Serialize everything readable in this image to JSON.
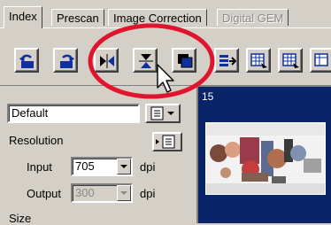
{
  "tabs": [
    {
      "label": "Index",
      "active": true,
      "enabled": true
    },
    {
      "label": "Prescan",
      "active": false,
      "enabled": true
    },
    {
      "label": "Image Correction",
      "active": false,
      "enabled": true
    },
    {
      "label": "Digital GEM",
      "active": false,
      "enabled": false
    }
  ],
  "toolbar": {
    "buttons": [
      {
        "icon": "rotate-left-icon"
      },
      {
        "icon": "rotate-right-icon"
      },
      {
        "icon": "flip-horizontal-icon"
      },
      {
        "icon": "flip-vertical-icon"
      },
      {
        "icon": "overlay-frames-icon"
      },
      {
        "icon": "frame-arrow-icon"
      },
      {
        "icon": "grid-select-icon"
      },
      {
        "icon": "grid-select-alt-icon"
      },
      {
        "icon": "grid-extra-icon"
      }
    ]
  },
  "settings": {
    "preset_value": "Default",
    "resolution_label": "Resolution",
    "input_label": "Input",
    "input_value": "705",
    "input_unit": "dpi",
    "output_label": "Output",
    "output_value": "300",
    "output_unit": "dpi",
    "size_label": "Size"
  },
  "preview": {
    "frame_number": "15"
  },
  "colors": {
    "window_bg": "#d4d0c8",
    "selection_blue": "#0a246a",
    "highlight_red": "#e0152d",
    "icon_blue": "#1030a0"
  }
}
